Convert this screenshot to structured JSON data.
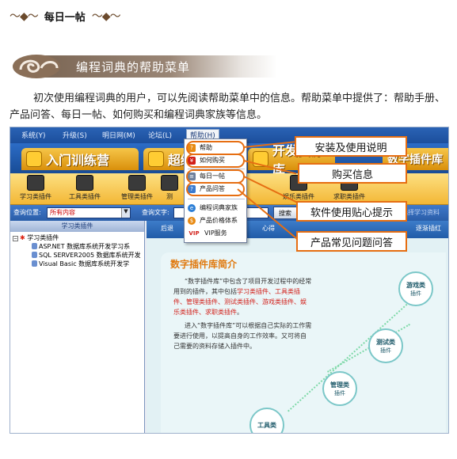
{
  "tip_header": {
    "left_ornament": "〜◆〜",
    "title": "每日一帖",
    "right_ornament": "〜◆〜"
  },
  "section_banner": {
    "title": "编程词典的帮助菜单"
  },
  "intro_paragraph": "初次使用编程词典的用户，可以先阅读帮助菜单中的信息。帮助菜单中提供了：帮助手册、产品问答、每日一帖、如何购买和编程词典家族等信息。",
  "app": {
    "menubar": [
      {
        "label": "系统(Y)"
      },
      {
        "label": "升级(S)"
      },
      {
        "label": "明日网(M)"
      },
      {
        "label": "论坛(L)"
      },
      {
        "label": "帮助(H)"
      }
    ],
    "big_tabs": [
      {
        "label": "入门训练营"
      },
      {
        "label": "超级"
      },
      {
        "label": "开发资源库"
      },
      {
        "label": "数字插件库"
      }
    ],
    "toolbar": [
      {
        "label": "学习类插件"
      },
      {
        "label": "工具类插件"
      },
      {
        "label": "管理类插件"
      },
      {
        "label": "测"
      },
      {
        "label": "娱乐类插件"
      },
      {
        "label": "求职类插件"
      }
    ],
    "search": {
      "location_label": "查询位置:",
      "location_value": "所有内容",
      "text_label": "查询文字:",
      "search_button": "搜索",
      "tip_text": "请选择学习资料"
    },
    "left_panel": {
      "title": "学习类插件",
      "root": "学习类插件",
      "children": [
        "ASP.NET 数据库系统开发学习系",
        "SQL SERVER2005 数据库系统开发",
        "Visual Basic 数据库系统开发学"
      ]
    },
    "navbar": {
      "back": "后退",
      "heart": "心得",
      "share": "逐渐插红"
    },
    "content": {
      "title": "数字插件库简介",
      "p1_a": "“数字插件库”中包含了项目开发过程中的经常用到的插件，其中包括",
      "p1_hl": "学习类插件、工具类插件、管理类插件、测试类插件、游戏类插件、娱乐类插件、求职类插件",
      "p1_b": "。",
      "p2": "进入“数字插件库”可以根据自己实际的工作需要进行使用，以提高自身的工作效率。又可将自己需要的资料存储入插件中。"
    },
    "nodes": [
      {
        "title": "游戏类",
        "sub": "插件"
      },
      {
        "title": "测试类",
        "sub": "插件"
      },
      {
        "title": "管理类",
        "sub": "插件"
      },
      {
        "title": "工具类",
        "sub": ""
      }
    ],
    "help_menu": {
      "items": [
        {
          "label": "帮助",
          "icon": "help-icon",
          "icon_text": "?"
        },
        {
          "label": "如何购买",
          "icon": "cart-icon",
          "icon_text": "¥"
        },
        {
          "label": "每日一帖",
          "icon": "note-icon",
          "icon_text": "≡"
        },
        {
          "label": "产品问答",
          "icon": "qa-icon",
          "icon_text": "?"
        },
        {
          "label": "编程词典家族",
          "icon": "globe-icon",
          "icon_text": "e"
        },
        {
          "label": "产品价格体系",
          "icon": "price-icon",
          "icon_text": "$"
        },
        {
          "label": "VIP服务",
          "icon": "vip-icon",
          "icon_text": "VIP"
        }
      ]
    }
  },
  "callouts": [
    {
      "text": "安装及使用说明"
    },
    {
      "text": "购买信息"
    },
    {
      "text": "软件使用贴心提示"
    },
    {
      "text": "产品常见问题问答"
    }
  ],
  "colors": {
    "accent": "#e66e12",
    "app_blue": "#215ca8",
    "tab_gold": "#f3b735",
    "banner_brown": "#7b6654"
  }
}
